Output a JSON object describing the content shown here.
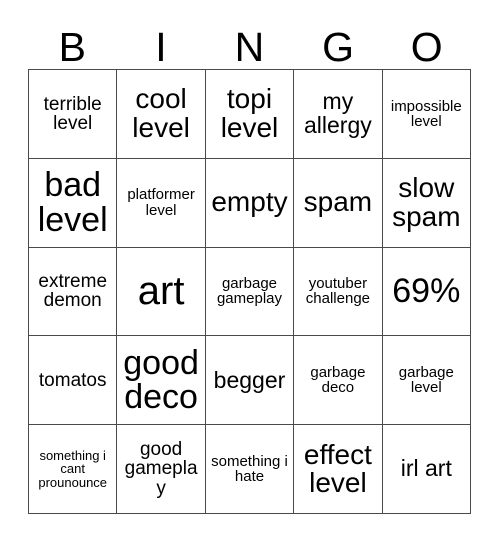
{
  "card": {
    "title": "BINGO",
    "background_color": "#ffffff",
    "grid_line_color": "#4a4a4a",
    "text_color": "#000000",
    "columns": 5,
    "rows": 5
  },
  "header": {
    "letters": [
      "B",
      "I",
      "N",
      "G",
      "O"
    ]
  },
  "cells": [
    {
      "text": "terrible level",
      "size": "fs-md"
    },
    {
      "text": "cool level",
      "size": "fs-xl"
    },
    {
      "text": "topi level",
      "size": "fs-xl"
    },
    {
      "text": "my allergy",
      "size": "fs-lg"
    },
    {
      "text": "impossible level",
      "size": "fs-sm"
    },
    {
      "text": "bad level",
      "size": "fs-xxl"
    },
    {
      "text": "platformer level",
      "size": "fs-sm"
    },
    {
      "text": "empty",
      "size": "fs-xl"
    },
    {
      "text": "spam",
      "size": "fs-xl"
    },
    {
      "text": "slow spam",
      "size": "fs-xl"
    },
    {
      "text": "extreme demon",
      "size": "fs-md"
    },
    {
      "text": "art",
      "size": "fs-huge"
    },
    {
      "text": "garbage gameplay",
      "size": "fs-sm"
    },
    {
      "text": "youtuber challenge",
      "size": "fs-sm"
    },
    {
      "text": "69%",
      "size": "fs-xxl"
    },
    {
      "text": "tomatos",
      "size": "fs-md"
    },
    {
      "text": "good deco",
      "size": "fs-xxl"
    },
    {
      "text": "begger",
      "size": "fs-lg"
    },
    {
      "text": "garbage deco",
      "size": "fs-sm"
    },
    {
      "text": "garbage level",
      "size": "fs-sm"
    },
    {
      "text": "something i cant prounounce",
      "size": "fs-xs"
    },
    {
      "text": "good gameplay",
      "size": "fs-md"
    },
    {
      "text": "something i hate",
      "size": "fs-sm"
    },
    {
      "text": "effect level",
      "size": "fs-xl"
    },
    {
      "text": "irl art",
      "size": "fs-lg"
    }
  ]
}
